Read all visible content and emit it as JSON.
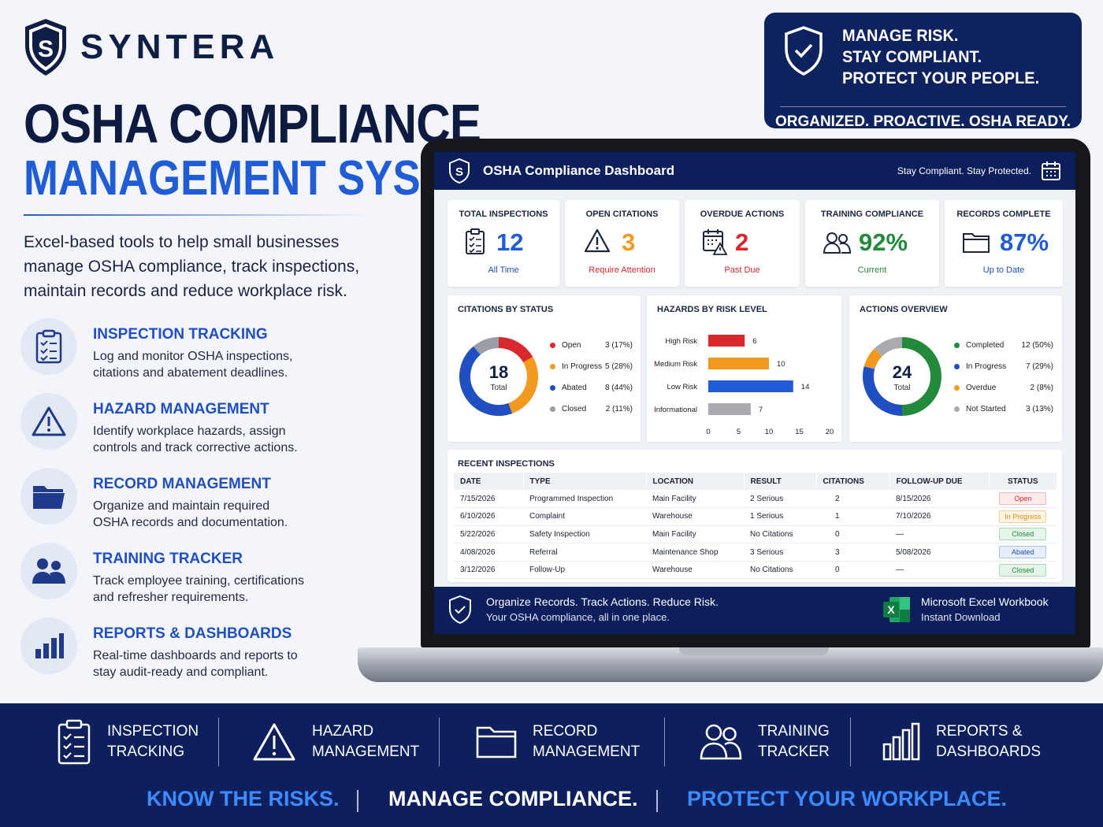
{
  "brand": {
    "name": "SYNTERA",
    "logo_letter": "S",
    "icon": "shield-logo"
  },
  "headline": {
    "line1": "OSHA COMPLIANCE",
    "line2": "MANAGEMENT SYSTEM"
  },
  "intro": "Excel-based tools to help small businesses manage OSHA compliance, track inspections, maintain records and reduce workplace risk.",
  "features": [
    {
      "icon": "clipboard-icon",
      "title": "INSPECTION TRACKING",
      "desc": "Log and monitor OSHA inspections,\ncitations and abatement deadlines."
    },
    {
      "icon": "warning-icon",
      "title": "HAZARD MANAGEMENT",
      "desc": "Identify workplace hazards, assign\ncontrols and track corrective actions."
    },
    {
      "icon": "folder-icon",
      "title": "RECORD MANAGEMENT",
      "desc": "Organize and maintain required\nOSHA records and documentation."
    },
    {
      "icon": "users-icon",
      "title": "TRAINING TRACKER",
      "desc": "Track employee training, certifications\nand refresher requirements."
    },
    {
      "icon": "bar-chart-icon",
      "title": "REPORTS & DASHBOARDS",
      "desc": "Real-time dashboards and reports to\nstay audit-ready and compliant."
    }
  ],
  "banner": {
    "lines": [
      "MANAGE RISK.",
      "STAY COMPLIANT.",
      "PROTECT YOUR PEOPLE."
    ],
    "tagline": "ORGANIZED. PROACTIVE. OSHA READY."
  },
  "dashboard": {
    "title": "OSHA Compliance Dashboard",
    "subtitle": "Stay Compliant. Stay Protected.",
    "kpis": [
      {
        "title": "TOTAL INSPECTIONS",
        "value": "12",
        "sub": "All Time",
        "color": "#1f5cd6",
        "icon": "clipboard-icon"
      },
      {
        "title": "OPEN CITATIONS",
        "value": "3",
        "sub": "Require Attention",
        "color": "#f39a1e",
        "sub_color": "#d9272e",
        "icon": "warning-icon"
      },
      {
        "title": "OVERDUE ACTIONS",
        "value": "2",
        "sub": "Past Due",
        "color": "#d9272e",
        "icon": "calendar-alert-icon"
      },
      {
        "title": "TRAINING COMPLIANCE",
        "value": "92%",
        "sub": "Current",
        "color": "#238a3b",
        "icon": "users-icon"
      },
      {
        "title": "RECORDS COMPLETE",
        "value": "87%",
        "sub": "Up to Date",
        "color": "#1f5cd6",
        "icon": "folder-icon"
      }
    ],
    "citations": {
      "title": "CITATIONS BY STATUS",
      "total": "18",
      "total_label": "Total",
      "items": [
        {
          "label": "Open",
          "count": 3,
          "value": "3 (17%)",
          "color": "#d9272e"
        },
        {
          "label": "In Progress",
          "count": 5,
          "value": "5 (28%)",
          "color": "#f39a1e"
        },
        {
          "label": "Abated",
          "count": 8,
          "value": "8 (44%)",
          "color": "#1f4fc2"
        },
        {
          "label": "Closed",
          "count": 2,
          "value": "2 (11%)",
          "color": "#9a9da3"
        }
      ]
    },
    "hazards": {
      "title": "HAZARDS BY RISK LEVEL",
      "bars": [
        {
          "label": "High Risk",
          "value": 6,
          "color": "#d9272e"
        },
        {
          "label": "Medium Risk",
          "value": 10,
          "color": "#f39a1e"
        },
        {
          "label": "Low Risk",
          "value": 14,
          "color": "#1f5cd6"
        },
        {
          "label": "Informational",
          "value": 7,
          "color": "#a9abb0"
        }
      ],
      "ticks": [
        "0",
        "5",
        "10",
        "15",
        "20"
      ],
      "max": 20
    },
    "actions": {
      "title": "ACTIONS OVERVIEW",
      "total": "24",
      "total_label": "Total",
      "items": [
        {
          "label": "Completed",
          "count": 12,
          "value": "12 (50%)",
          "color": "#238a3b"
        },
        {
          "label": "In Progress",
          "count": 7,
          "value": "7 (29%)",
          "color": "#1f4fc2"
        },
        {
          "label": "Overdue",
          "count": 2,
          "value": "2 (8%)",
          "color": "#f39a1e"
        },
        {
          "label": "Not Started",
          "count": 3,
          "value": "3 (13%)",
          "color": "#a9abb0"
        }
      ]
    },
    "recent": {
      "title": "RECENT INSPECTIONS",
      "columns": [
        "DATE",
        "TYPE",
        "LOCATION",
        "RESULT",
        "CITATIONS",
        "FOLLOW-UP DUE",
        "STATUS"
      ],
      "rows": [
        {
          "date": "7/15/2026",
          "type": "Programmed Inspection",
          "location": "Main Facility",
          "result": "2 Serious",
          "citations": "2",
          "followup": "8/15/2026",
          "status": "Open",
          "status_kind": "open"
        },
        {
          "date": "6/10/2026",
          "type": "Complaint",
          "location": "Warehouse",
          "result": "1 Serious",
          "citations": "1",
          "followup": "7/10/2026",
          "status": "In Progress",
          "status_kind": "progress"
        },
        {
          "date": "5/22/2026",
          "type": "Safety Inspection",
          "location": "Main Facility",
          "result": "No Citations",
          "citations": "0",
          "followup": "—",
          "status": "Closed",
          "status_kind": "closed"
        },
        {
          "date": "4/08/2026",
          "type": "Referral",
          "location": "Maintenance Shop",
          "result": "3 Serious",
          "citations": "3",
          "followup": "5/08/2026",
          "status": "Abated",
          "status_kind": "abated"
        },
        {
          "date": "3/12/2026",
          "type": "Follow-Up",
          "location": "Warehouse",
          "result": "No Citations",
          "citations": "0",
          "followup": "—",
          "status": "Closed",
          "status_kind": "closed"
        }
      ]
    },
    "footer": {
      "line1": "Organize Records. Track Actions. Reduce Risk.",
      "line2": "Your OSHA compliance, all in one place.",
      "excel1": "Microsoft Excel Workbook",
      "excel2": "Instant Download",
      "excel_letter": "X"
    }
  },
  "bottom": {
    "items": [
      {
        "icon": "clipboard-icon",
        "label": "INSPECTION\nTRACKING"
      },
      {
        "icon": "warning-icon",
        "label": "HAZARD\nMANAGEMENT"
      },
      {
        "icon": "folder-icon",
        "label": "RECORD\nMANAGEMENT"
      },
      {
        "icon": "users-icon",
        "label": "TRAINING\nTRACKER"
      },
      {
        "icon": "bar-chart-icon",
        "label": "REPORTS &\nDASHBOARDS"
      }
    ],
    "slogans": [
      {
        "text": "KNOW THE RISKS.",
        "color": "#3d8bff"
      },
      {
        "text": "MANAGE COMPLIANCE.",
        "color": "#ffffff"
      },
      {
        "text": "PROTECT YOUR WORKPLACE.",
        "color": "#3d8bff"
      }
    ]
  }
}
